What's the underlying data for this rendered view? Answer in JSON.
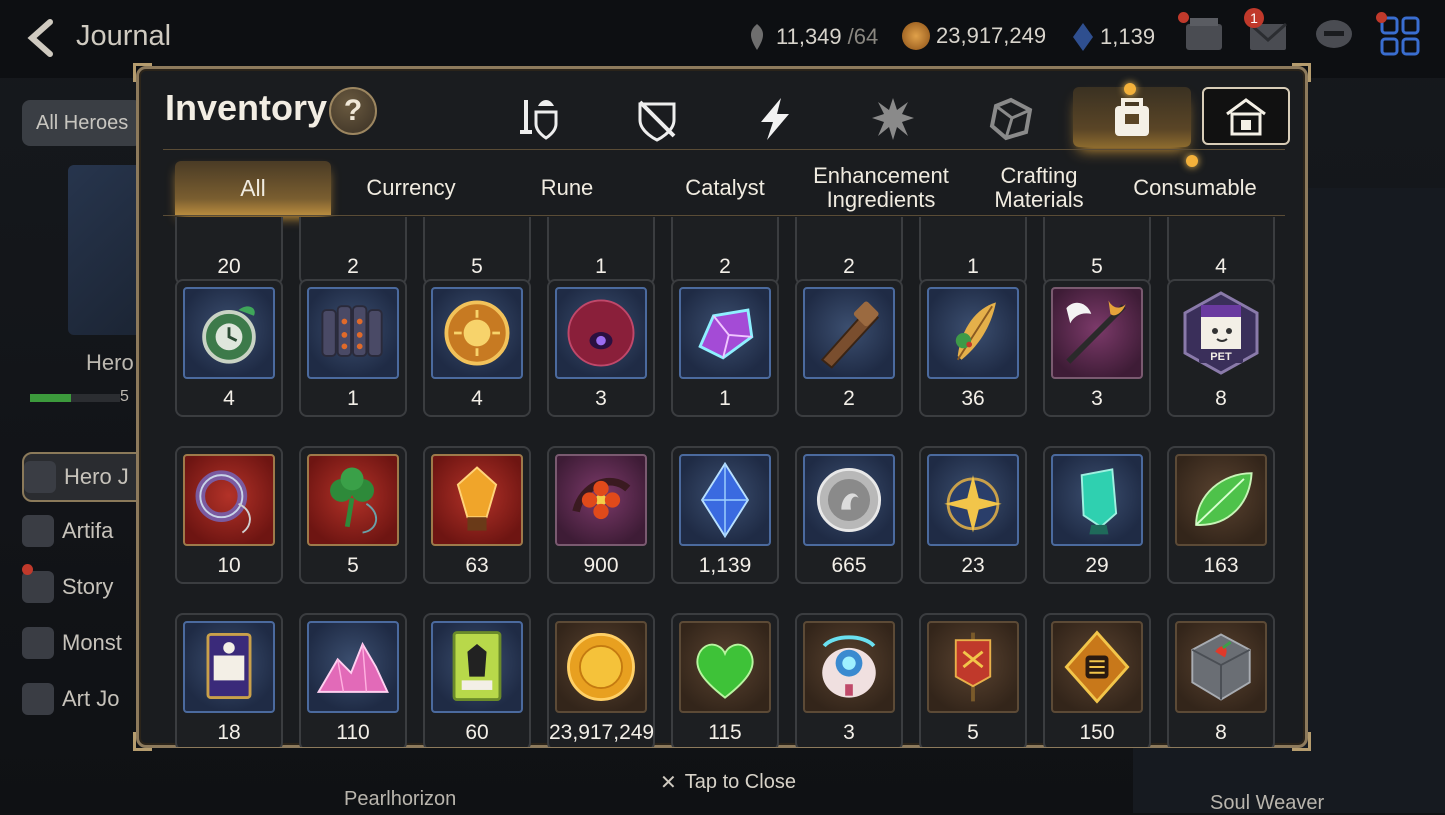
{
  "header": {
    "title": "Journal",
    "stamina": "11,349",
    "stamina_max": "/64",
    "gold": "23,917,249",
    "skystone": "1,139",
    "mail_badge": "1"
  },
  "background": {
    "side_tab": "All Heroes",
    "hero_label": "Hero",
    "progress_text": "5",
    "nav": [
      "Hero J",
      "Artifa",
      "Story",
      "Monst",
      "Art Jo"
    ],
    "footer_left": "Pearlhorizon",
    "footer_right": "Soul Weaver"
  },
  "inventory": {
    "title": "Inventory",
    "help": "?",
    "category_icons": [
      "equipment-icon",
      "artifact-shield-icon",
      "lightning-icon",
      "burst-icon",
      "cube-icon",
      "bag-icon",
      "pet-house-icon"
    ],
    "tabs": [
      "All",
      "Currency",
      "Rune",
      "Catalyst",
      "Enhancement Ingredients",
      "Crafting Materials",
      "Consumable"
    ],
    "active_tab": "All"
  },
  "rows": [
    {
      "items": [
        {
          "name": "partial-item",
          "qty": "20"
        },
        {
          "name": "partial-item",
          "qty": "2"
        },
        {
          "name": "partial-item",
          "qty": "5"
        },
        {
          "name": "partial-item",
          "qty": "1"
        },
        {
          "name": "partial-item",
          "qty": "2"
        },
        {
          "name": "partial-item",
          "qty": "2"
        },
        {
          "name": "partial-item",
          "qty": "1"
        },
        {
          "name": "partial-item",
          "qty": "5"
        },
        {
          "name": "partial-item",
          "qty": "4"
        }
      ]
    },
    {
      "items": [
        {
          "name": "green-pocket-watch",
          "qty": "4",
          "bg": "blue",
          "icon": "watch-icon"
        },
        {
          "name": "dark-scale-plates",
          "qty": "1",
          "bg": "blue",
          "icon": "scales-icon"
        },
        {
          "name": "sun-medallion",
          "qty": "4",
          "bg": "blue",
          "icon": "sun-coin-icon"
        },
        {
          "name": "crimson-eye-orb",
          "qty": "3",
          "bg": "blue",
          "icon": "eye-orb-icon"
        },
        {
          "name": "prism-crystal",
          "qty": "1",
          "bg": "blue",
          "icon": "crystal-icon"
        },
        {
          "name": "wooden-club",
          "qty": "2",
          "bg": "blue",
          "icon": "club-icon"
        },
        {
          "name": "golden-feather",
          "qty": "36",
          "bg": "blue",
          "icon": "feather-icon"
        },
        {
          "name": "feather-staff",
          "qty": "3",
          "bg": "purple",
          "icon": "staff-icon"
        },
        {
          "name": "pet-snack-pack",
          "qty": "8",
          "bg": "hex",
          "icon": "pet-pack-icon",
          "pet_label": "PET"
        }
      ]
    },
    {
      "items": [
        {
          "name": "blue-ring-pendant",
          "qty": "10",
          "bg": "red",
          "icon": "ring-icon"
        },
        {
          "name": "clover-charm",
          "qty": "5",
          "bg": "red",
          "icon": "clover-icon"
        },
        {
          "name": "amber-shard",
          "qty": "63",
          "bg": "red",
          "icon": "amber-icon"
        },
        {
          "name": "flower-crest",
          "qty": "900",
          "bg": "purple",
          "icon": "flower-crest-icon"
        },
        {
          "name": "sky-stone",
          "qty": "1,139",
          "bg": "blue",
          "icon": "gem-icon"
        },
        {
          "name": "silver-coin",
          "qty": "665",
          "bg": "blue",
          "icon": "coin-icon"
        },
        {
          "name": "star-amulet",
          "qty": "23",
          "bg": "blue",
          "icon": "star-icon"
        },
        {
          "name": "teal-crystal",
          "qty": "29",
          "bg": "blue",
          "icon": "teal-crystal-icon"
        },
        {
          "name": "glowing-leaf",
          "qty": "163",
          "bg": "brown",
          "icon": "leaf-icon"
        }
      ]
    },
    {
      "items": [
        {
          "name": "certificate-card",
          "qty": "18",
          "bg": "blue",
          "icon": "card-icon"
        },
        {
          "name": "pink-crystal-pile",
          "qty": "110",
          "bg": "blue",
          "icon": "crystal-pile-icon"
        },
        {
          "name": "costume-card",
          "qty": "60",
          "bg": "blue",
          "icon": "costume-card-icon"
        },
        {
          "name": "gold-coin",
          "qty": "23,917,249",
          "bg": "brown",
          "icon": "gold-coin-icon"
        },
        {
          "name": "green-heart",
          "qty": "115",
          "bg": "brown",
          "icon": "heart-icon"
        },
        {
          "name": "robot-pod",
          "qty": "3",
          "bg": "brown",
          "icon": "robot-icon"
        },
        {
          "name": "battle-banner",
          "qty": "5",
          "bg": "brown",
          "icon": "banner-icon"
        },
        {
          "name": "fist-emblem",
          "qty": "150",
          "bg": "brown",
          "icon": "fist-emblem-icon"
        },
        {
          "name": "stone-cube",
          "qty": "8",
          "bg": "brown",
          "icon": "stone-cube-icon"
        }
      ]
    }
  ],
  "footer": {
    "tap_to_close": "Tap to Close"
  }
}
